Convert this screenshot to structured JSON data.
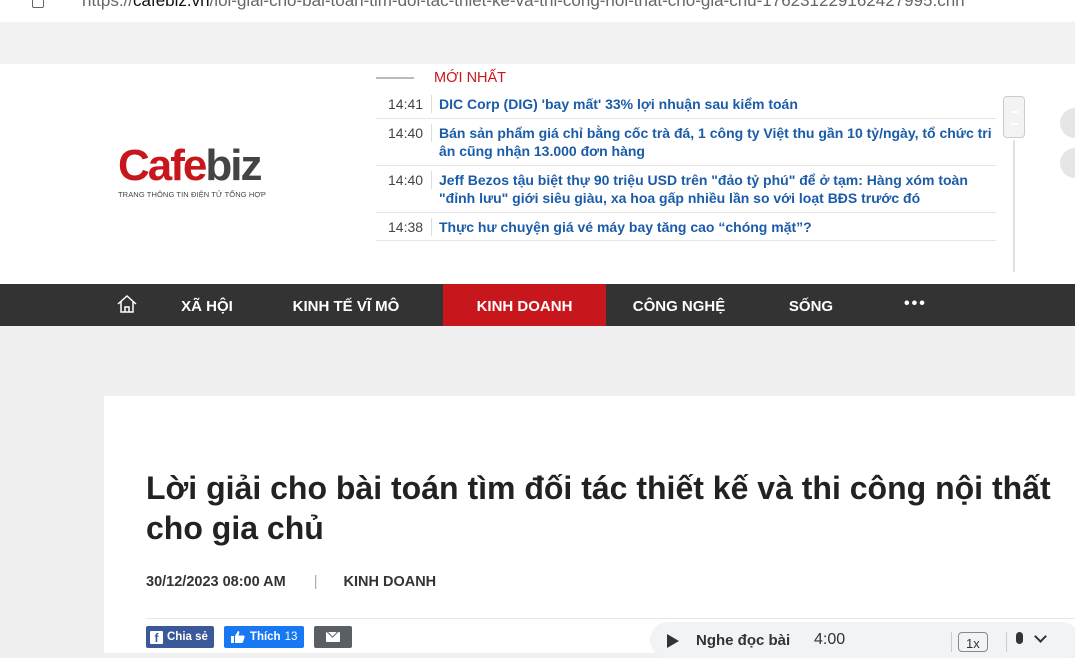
{
  "browser": {
    "url_prefix": "https://",
    "url_domain": "cafebiz.vn",
    "url_path": "/loi-giai-cho-bai-toan-tim-doi-tac-thiet-ke-va-thi-cong-noi-that-cho-gia-chu-176231229162427995.chn"
  },
  "logo": {
    "part1": "Cafe",
    "part2": "biz",
    "tagline": "TRANG THÔNG TIN ĐIỆN TỬ TỔNG HỢP"
  },
  "latest": {
    "label": "MỚI NHẤT",
    "items": [
      {
        "time": "14:41",
        "title": "DIC Corp (DIG) 'bay mất' 33% lợi nhuận sau kiểm toán"
      },
      {
        "time": "14:40",
        "title": "Bán sản phẩm giá chỉ bằng cốc trà đá, 1 công ty Việt thu gần 10 tỷ/ngày, tổ chức tri ân cũng nhận 13.000 đơn hàng"
      },
      {
        "time": "14:40",
        "title": "Jeff Bezos tậu biệt thự 90 triệu USD trên \"đảo tỷ phú\" để ở tạm: Hàng xóm toàn \"đỉnh lưu\" giới siêu giàu, xa hoa gấp nhiều lần so với loạt BĐS trước đó"
      },
      {
        "time": "14:38",
        "title": "Thực hư chuyện giá vé máy bay tăng cao “chóng mặt”?"
      }
    ]
  },
  "nav": {
    "items": [
      {
        "label": "XÃ HỘI"
      },
      {
        "label": "KINH TẾ VĨ MÔ"
      },
      {
        "label": "KINH DOANH",
        "active": true
      },
      {
        "label": "CÔNG NGHỆ"
      },
      {
        "label": "SỐNG"
      }
    ],
    "more": "•••"
  },
  "article": {
    "title": "Lời giải cho bài toán tìm đối tác thiết kế và thi công nội thất cho gia chủ",
    "date": "30/12/2023 08:00 AM",
    "separator": "|",
    "category": "KINH DOANH"
  },
  "share": {
    "facebook_label": "Chia sẻ",
    "like_label": "Thích",
    "like_count": "13"
  },
  "audio": {
    "label": "Nghe đọc bài",
    "duration": "4:00",
    "speed": "1x"
  },
  "colors": {
    "brand_red": "#c8161d",
    "link_blue": "#1b5ca8",
    "nav_bg": "#333333",
    "facebook": "#3b5998",
    "like": "#1877f2"
  }
}
